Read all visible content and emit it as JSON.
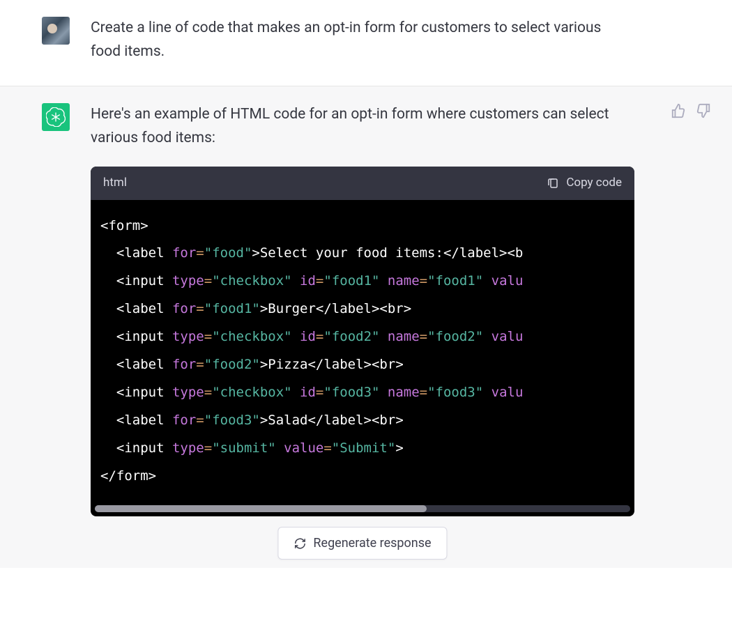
{
  "user_message": {
    "text": "Create a line of code that makes an opt-in form for customers to select various food items."
  },
  "assistant_message": {
    "intro": "Here's an example of HTML code for an opt-in form where customers can select various food items:"
  },
  "code_block": {
    "language": "html",
    "copy_label": "Copy code",
    "lines": [
      {
        "indent": 0,
        "parts": [
          {
            "t": "tag",
            "v": "<form>"
          }
        ]
      },
      {
        "indent": 1,
        "parts": [
          {
            "t": "tag",
            "v": "<label "
          },
          {
            "t": "attr",
            "v": "for"
          },
          {
            "t": "eq",
            "v": "="
          },
          {
            "t": "val",
            "v": "\"food\""
          },
          {
            "t": "tag",
            "v": ">"
          },
          {
            "t": "text",
            "v": "Select your food items:"
          },
          {
            "t": "tag",
            "v": "</label><b"
          }
        ]
      },
      {
        "indent": 1,
        "parts": [
          {
            "t": "tag",
            "v": "<input "
          },
          {
            "t": "attr",
            "v": "type"
          },
          {
            "t": "eq",
            "v": "="
          },
          {
            "t": "val",
            "v": "\"checkbox\" "
          },
          {
            "t": "attr",
            "v": "id"
          },
          {
            "t": "eq",
            "v": "="
          },
          {
            "t": "val",
            "v": "\"food1\" "
          },
          {
            "t": "attr",
            "v": "name"
          },
          {
            "t": "eq",
            "v": "="
          },
          {
            "t": "val",
            "v": "\"food1\" "
          },
          {
            "t": "attr",
            "v": "valu"
          }
        ]
      },
      {
        "indent": 1,
        "parts": [
          {
            "t": "tag",
            "v": "<label "
          },
          {
            "t": "attr",
            "v": "for"
          },
          {
            "t": "eq",
            "v": "="
          },
          {
            "t": "val",
            "v": "\"food1\""
          },
          {
            "t": "tag",
            "v": ">"
          },
          {
            "t": "text",
            "v": "Burger"
          },
          {
            "t": "tag",
            "v": "</label><br>"
          }
        ]
      },
      {
        "indent": 1,
        "parts": [
          {
            "t": "tag",
            "v": "<input "
          },
          {
            "t": "attr",
            "v": "type"
          },
          {
            "t": "eq",
            "v": "="
          },
          {
            "t": "val",
            "v": "\"checkbox\" "
          },
          {
            "t": "attr",
            "v": "id"
          },
          {
            "t": "eq",
            "v": "="
          },
          {
            "t": "val",
            "v": "\"food2\" "
          },
          {
            "t": "attr",
            "v": "name"
          },
          {
            "t": "eq",
            "v": "="
          },
          {
            "t": "val",
            "v": "\"food2\" "
          },
          {
            "t": "attr",
            "v": "valu"
          }
        ]
      },
      {
        "indent": 1,
        "parts": [
          {
            "t": "tag",
            "v": "<label "
          },
          {
            "t": "attr",
            "v": "for"
          },
          {
            "t": "eq",
            "v": "="
          },
          {
            "t": "val",
            "v": "\"food2\""
          },
          {
            "t": "tag",
            "v": ">"
          },
          {
            "t": "text",
            "v": "Pizza"
          },
          {
            "t": "tag",
            "v": "</label><br>"
          }
        ]
      },
      {
        "indent": 1,
        "parts": [
          {
            "t": "tag",
            "v": "<input "
          },
          {
            "t": "attr",
            "v": "type"
          },
          {
            "t": "eq",
            "v": "="
          },
          {
            "t": "val",
            "v": "\"checkbox\" "
          },
          {
            "t": "attr",
            "v": "id"
          },
          {
            "t": "eq",
            "v": "="
          },
          {
            "t": "val",
            "v": "\"food3\" "
          },
          {
            "t": "attr",
            "v": "name"
          },
          {
            "t": "eq",
            "v": "="
          },
          {
            "t": "val",
            "v": "\"food3\" "
          },
          {
            "t": "attr",
            "v": "valu"
          }
        ]
      },
      {
        "indent": 1,
        "parts": [
          {
            "t": "tag",
            "v": "<label "
          },
          {
            "t": "attr",
            "v": "for"
          },
          {
            "t": "eq",
            "v": "="
          },
          {
            "t": "val",
            "v": "\"food3\""
          },
          {
            "t": "tag",
            "v": ">"
          },
          {
            "t": "text",
            "v": "Salad"
          },
          {
            "t": "tag",
            "v": "</label><br>"
          }
        ]
      },
      {
        "indent": 1,
        "parts": [
          {
            "t": "tag",
            "v": "<input "
          },
          {
            "t": "attr",
            "v": "type"
          },
          {
            "t": "eq",
            "v": "="
          },
          {
            "t": "val",
            "v": "\"submit\" "
          },
          {
            "t": "attr",
            "v": "value"
          },
          {
            "t": "eq",
            "v": "="
          },
          {
            "t": "val",
            "v": "\"Submit\""
          },
          {
            "t": "tag",
            "v": ">"
          }
        ]
      },
      {
        "indent": 0,
        "parts": [
          {
            "t": "tag",
            "v": "</form>"
          }
        ]
      }
    ]
  },
  "buttons": {
    "regenerate": "Regenerate response"
  },
  "icons": {
    "thumbs_up": "thumbs-up-icon",
    "thumbs_down": "thumbs-down-icon",
    "copy": "clipboard-icon",
    "regen": "refresh-icon",
    "assistant_logo": "openai-logo-icon"
  }
}
